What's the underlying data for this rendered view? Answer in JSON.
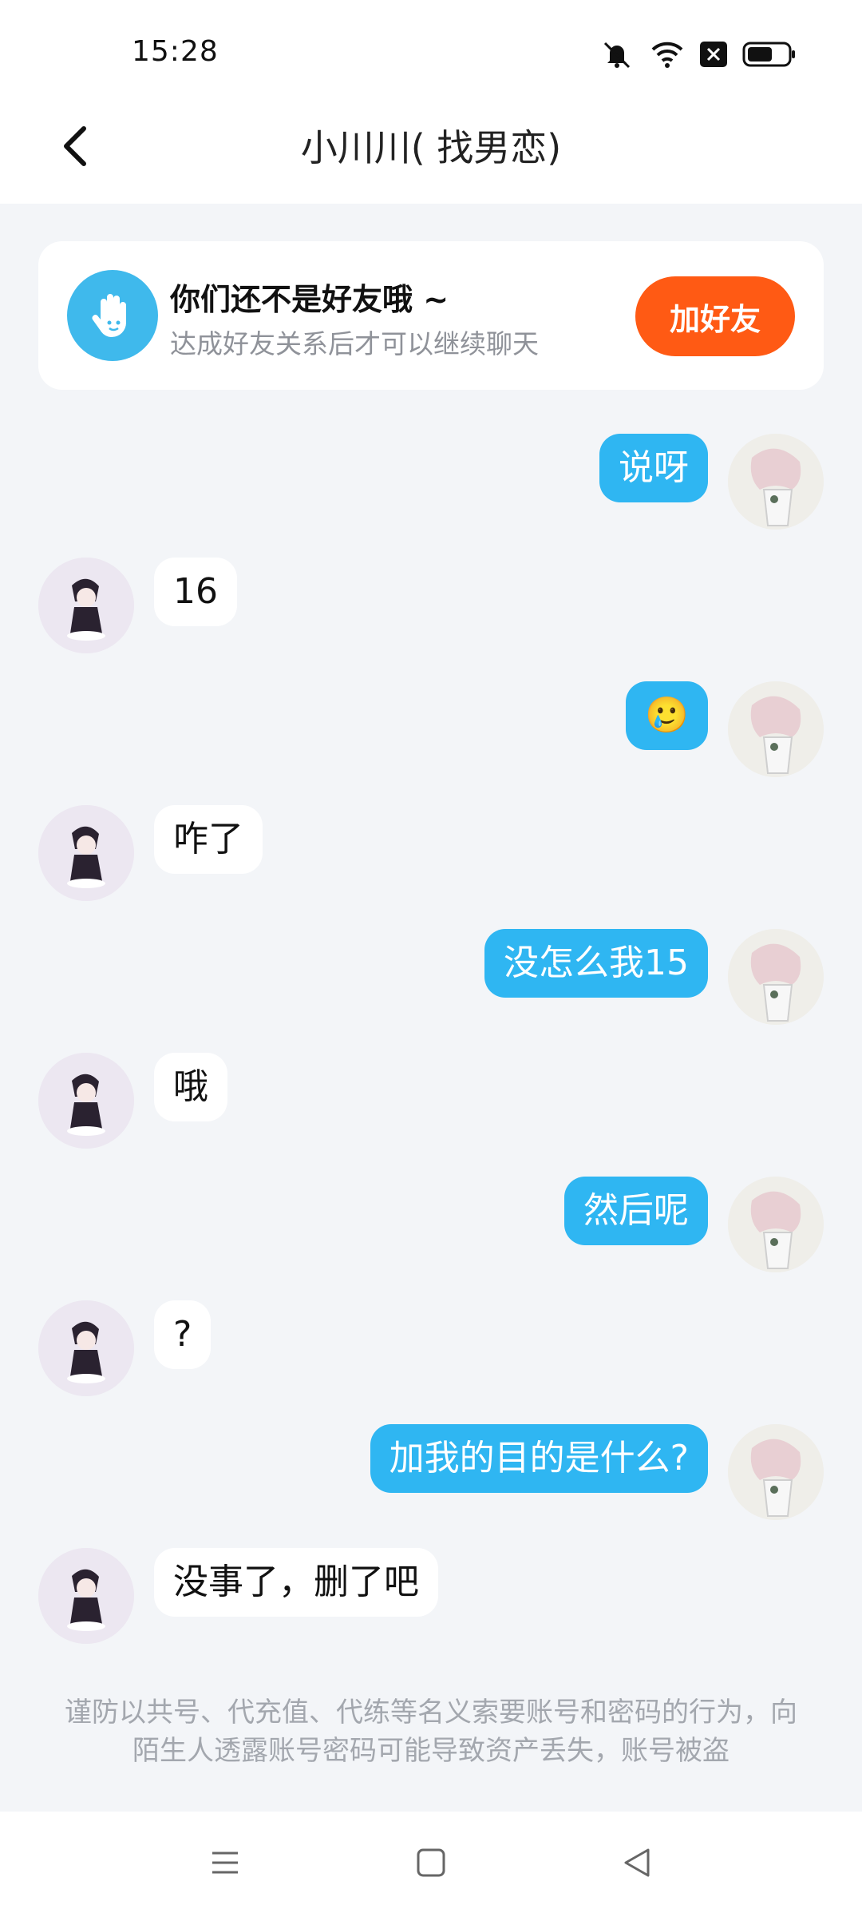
{
  "status_bar": {
    "time": "15:28",
    "icons": [
      "mute-icon",
      "wifi-icon",
      "sim-blocked-icon",
      "battery-icon"
    ]
  },
  "header": {
    "title": "小川川( 找男恋)",
    "back_icon": "chevron-left-icon"
  },
  "friend_banner": {
    "title": "你们还不是好友哦 ~",
    "subtitle": "达成好友关系后才可以继续聊天",
    "button_label": "加好友",
    "icon": "hand-wave-icon"
  },
  "messages": [
    {
      "side": "out",
      "text": "说呀"
    },
    {
      "side": "in",
      "text": "16"
    },
    {
      "side": "out",
      "text": "🥲"
    },
    {
      "side": "in",
      "text": "咋了"
    },
    {
      "side": "out",
      "text": "没怎么我15"
    },
    {
      "side": "in",
      "text": "哦"
    },
    {
      "side": "out",
      "text": "然后呢"
    },
    {
      "side": "in",
      "text": "?"
    },
    {
      "side": "out",
      "text": "加我的目的是什么?"
    },
    {
      "side": "in",
      "text": "没事了，删了吧"
    }
  ],
  "notice": "谨防以共号、代充值、代练等名义索要账号和密码的行为，向陌生人透露账号密码可能导致资产丢失，账号被盗",
  "nav_bar": {
    "buttons": [
      "menu-icon",
      "home-icon",
      "back-icon"
    ]
  },
  "colors": {
    "accent_blue": "#2fb6f2",
    "button_orange": "#ff5a14",
    "background": "#f3f5f8"
  }
}
